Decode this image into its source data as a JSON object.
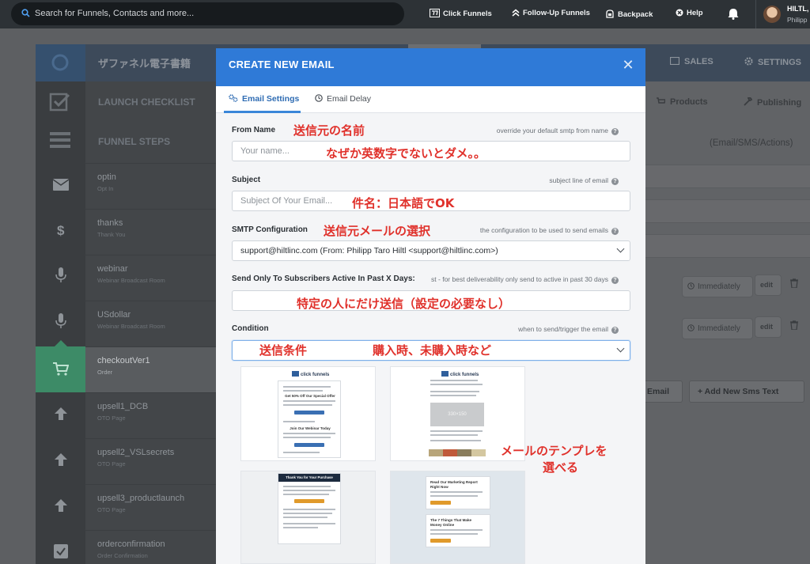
{
  "topbar": {
    "search_placeholder": "Search for Funnels, Contacts and more...",
    "nav": [
      {
        "label": "Click Funnels",
        "icon": "clickfunnels-logo-icon"
      },
      {
        "label": "Follow-Up Funnels",
        "icon": "double-chevron-up-icon"
      },
      {
        "label": "Backpack",
        "icon": "backpack-icon"
      },
      {
        "label": "Help",
        "icon": "help-circle-icon"
      }
    ],
    "user_name": "HILTL,",
    "user_sub": "Philipp"
  },
  "background": {
    "funnel_title": "ザファネル電子書籍",
    "header_nav": [
      "SALES",
      "SETTINGS"
    ],
    "subnav": [
      "Products",
      "Publishing"
    ],
    "launch_checklist": "LAUNCH CHECKLIST",
    "funnel_steps": "FUNNEL STEPS",
    "right_heading": "(Email/SMS/Actions)",
    "steps": [
      {
        "name": "optin",
        "sub": "Opt In"
      },
      {
        "name": "thanks",
        "sub": "Thank You"
      },
      {
        "name": "webinar",
        "sub": "Webinar Broadcast Room"
      },
      {
        "name": "USdollar",
        "sub": "Webinar Broadcast Room"
      },
      {
        "name": "checkoutVer1",
        "sub": "Order"
      },
      {
        "name": "upsell1_DCB",
        "sub": "OTO Page"
      },
      {
        "name": "upsell2_VSLsecrets",
        "sub": "OTO Page"
      },
      {
        "name": "upsell3_productlaunch",
        "sub": "OTO Page"
      },
      {
        "name": "orderconfirmation",
        "sub": "Order Confirmation"
      }
    ],
    "immediately": "Immediately",
    "edit": "edit",
    "email_btn": "Email",
    "add_sms_btn": "+ Add New Sms Text"
  },
  "modal": {
    "title": "CREATE NEW EMAIL",
    "tabs": [
      {
        "label": "Email Settings",
        "icon": "gears-icon"
      },
      {
        "label": "Email Delay",
        "icon": "clock-icon"
      }
    ],
    "from_name": {
      "label": "From Name",
      "hint": "override your default smtp from name",
      "placeholder": "Your name..."
    },
    "subject": {
      "label": "Subject",
      "hint": "subject line of email",
      "placeholder": "Subject Of Your Email..."
    },
    "smtp": {
      "label": "SMTP Configuration",
      "hint": "the configuration to be used to send emails",
      "value": "support@hiltlinc.com (From: Philipp Taro Hiltl <support@hiltlinc.com>)"
    },
    "send_only": {
      "label": "Send Only To Subscribers Active In Past X Days:",
      "hint": "st - for best deliverability only send to active in past 30 days",
      "value": ""
    },
    "condition": {
      "label": "Condition",
      "hint": "when to send/trigger the email",
      "value": ""
    },
    "templates": [
      {
        "logo": "click funnels",
        "heading": "Get 50% Off Our Special Offer",
        "heading2": "Join Our Webinar Today"
      },
      {
        "logo": "click funnels",
        "image_label": "330×150"
      },
      {
        "heading": "Thank You for Your Purchase"
      },
      {
        "heading": "Read Our Marketing Report Right Now",
        "heading2": "The 7 Things That Make Money Online"
      }
    ]
  },
  "annotations": {
    "from_name": "送信元の名前",
    "english_only": "なぜか英数字でないとダメ。。",
    "subject_ok": "件名：日本語でOK",
    "smtp_select": "送信元メールの選択",
    "send_specific": "特定の人にだけ送信（設定の必要なし）",
    "condition": "送信条件",
    "purchase_cond": "購入時、未購入時など",
    "template_line1": "メールのテンプレを",
    "template_line2": "選べる"
  }
}
